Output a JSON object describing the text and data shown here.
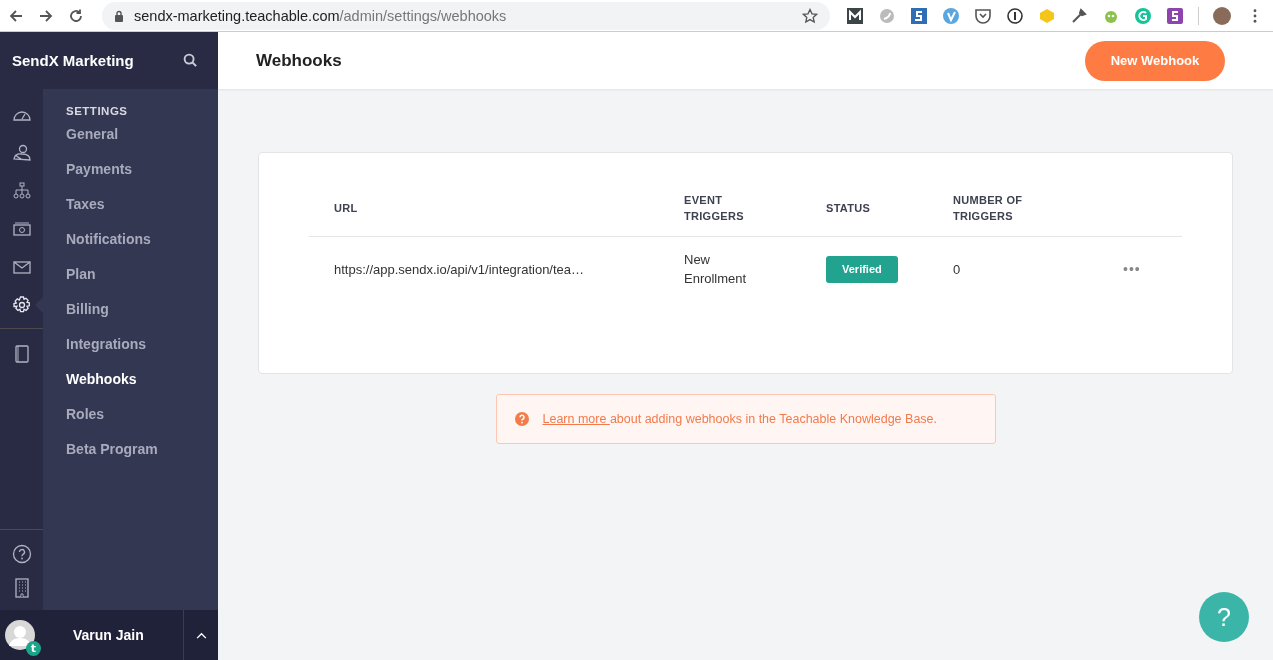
{
  "browser": {
    "url_host": "sendx-marketing.teachable.com",
    "url_path": "/admin/settings/webhooks"
  },
  "sidebar": {
    "school_name": "SendX Marketing",
    "section_title": "SETTINGS",
    "rail": [
      {
        "kind": "gauge",
        "selected": false
      },
      {
        "kind": "users",
        "selected": false
      },
      {
        "kind": "sitemap",
        "selected": false
      },
      {
        "kind": "money",
        "selected": false
      },
      {
        "kind": "mail",
        "selected": false
      },
      {
        "kind": "gear",
        "selected": true
      },
      {
        "kind": "book",
        "selected": false
      }
    ],
    "items": [
      {
        "label": "General",
        "selected": false
      },
      {
        "label": "Payments",
        "selected": false
      },
      {
        "label": "Taxes",
        "selected": false
      },
      {
        "label": "Notifications",
        "selected": false
      },
      {
        "label": "Plan",
        "selected": false
      },
      {
        "label": "Billing",
        "selected": false
      },
      {
        "label": "Integrations",
        "selected": false
      },
      {
        "label": "Webhooks",
        "selected": true
      },
      {
        "label": "Roles",
        "selected": false
      },
      {
        "label": "Beta Program",
        "selected": false
      }
    ],
    "user": {
      "name": "Varun Jain",
      "badge": "t"
    }
  },
  "header": {
    "title": "Webhooks",
    "button": "New Webhook"
  },
  "table": {
    "columns": [
      "URL",
      "EVENT TRIGGERS",
      "STATUS",
      "NUMBER OF TRIGGERS"
    ],
    "rows": [
      {
        "url": "https://app.sendx.io/api/v1/integration/tea…",
        "event": "New Enrollment",
        "status": "Verified",
        "count": "0",
        "menu": "•••"
      }
    ]
  },
  "notice": {
    "link": "Learn more ",
    "text": "about adding webhooks in the Teachable Knowledge Base."
  },
  "help_button": "?"
}
